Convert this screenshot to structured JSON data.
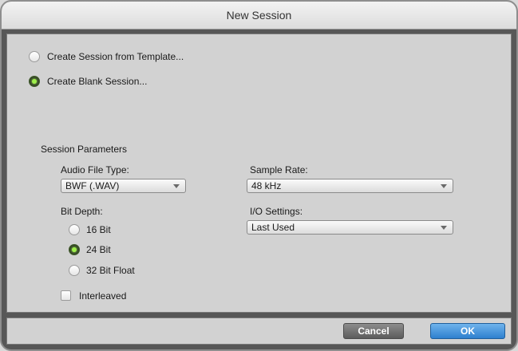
{
  "window": {
    "title": "New Session"
  },
  "options": {
    "template_label": "Create Session from Template...",
    "blank_label": "Create Blank Session...",
    "selected": "blank"
  },
  "params": {
    "heading": "Session Parameters",
    "audio_file_type": {
      "label": "Audio File Type:",
      "value": "BWF (.WAV)"
    },
    "sample_rate": {
      "label": "Sample Rate:",
      "value": "48 kHz"
    },
    "io_settings": {
      "label": "I/O Settings:",
      "value": "Last Used"
    },
    "bit_depth": {
      "label": "Bit Depth:",
      "options": [
        "16 Bit",
        "24 Bit",
        "32 Bit Float"
      ],
      "selected": "24 Bit"
    },
    "interleaved": {
      "label": "Interleaved",
      "checked": false
    }
  },
  "buttons": {
    "cancel": "Cancel",
    "ok": "OK"
  },
  "colors": {
    "ok_blue": "#2e80cf",
    "radio_green": "#9ef04a"
  }
}
